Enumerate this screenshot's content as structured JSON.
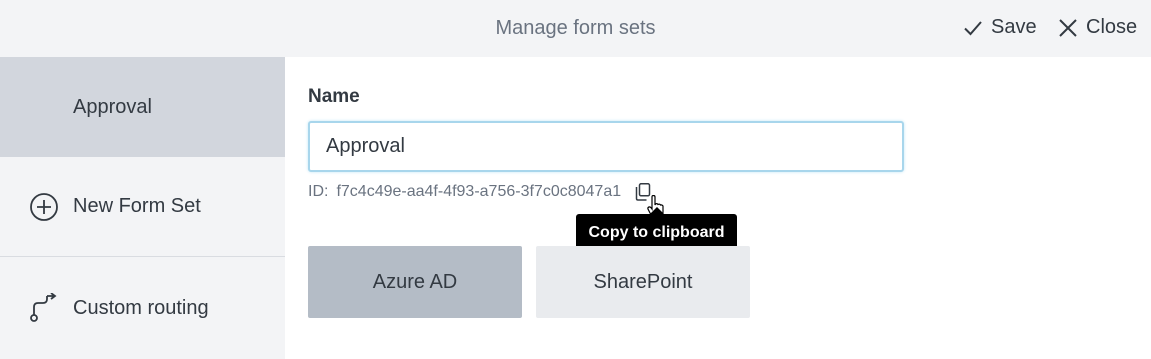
{
  "header": {
    "title": "Manage form sets",
    "save_label": "Save",
    "close_label": "Close",
    "save_icon": "checkmark-icon",
    "close_icon": "x-close-icon"
  },
  "sidebar": {
    "items": [
      {
        "label": "Approval",
        "active": true
      },
      {
        "label": "New Form Set",
        "icon": "plus-circle-icon"
      },
      {
        "label": "Custom routing",
        "icon": "route-icon"
      }
    ]
  },
  "main": {
    "name_label": "Name",
    "name_value": "Approval",
    "id_prefix": "ID:",
    "id_value": "f7c4c49e-aa4f-4f93-a756-3f7c0c8047a1",
    "copy_icon": "copy-icon",
    "tooltip": "Copy to clipboard",
    "tiles": [
      {
        "label": "Azure AD",
        "selected": true
      },
      {
        "label": "SharePoint",
        "selected": false
      }
    ]
  },
  "colors": {
    "header_bg": "#f3f4f6",
    "sidebar_active_bg": "#d2d6dd",
    "input_focus_border": "#a8d6ec",
    "tile_selected_bg": "#b4bcc6",
    "tile_bg": "#e9ebee"
  }
}
